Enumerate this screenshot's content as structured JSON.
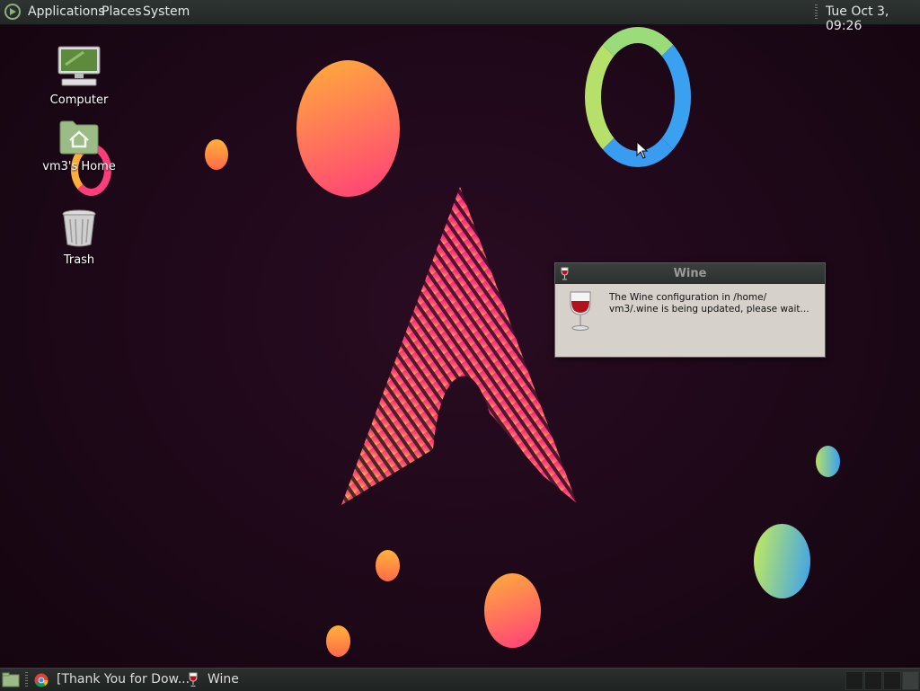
{
  "top_panel": {
    "menus": [
      "Applications",
      "Places",
      "System"
    ],
    "clock": "Tue Oct  3, 09:26"
  },
  "desktop": {
    "icons": [
      {
        "label": "Computer",
        "icon": "computer-icon"
      },
      {
        "label": "vm3's Home",
        "icon": "home-folder-icon"
      },
      {
        "label": "Trash",
        "icon": "trash-icon"
      }
    ]
  },
  "wine_dialog": {
    "title": "Wine",
    "message_line1": "The Wine configuration in /home/",
    "message_line2": "vm3/.wine is being updated, please wait..."
  },
  "bottom_panel": {
    "tasks": [
      {
        "label": "[Thank You for Dow...",
        "icon": "chrome-icon"
      },
      {
        "label": "Wine",
        "icon": "wine-glass-icon"
      }
    ]
  },
  "colors": {
    "panel": "#2b302e",
    "accent_pink": "#ff2d8a",
    "accent_orange": "#ffae3a",
    "dialog_bg": "#d6d2cb"
  }
}
